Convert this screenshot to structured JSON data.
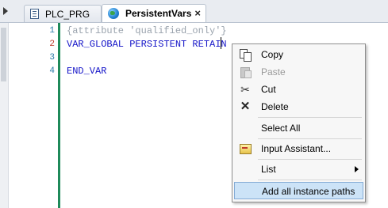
{
  "tabs": [
    {
      "label": "PLC_PRG",
      "icon": "program-icon",
      "active": false
    },
    {
      "label": "PersistentVars",
      "icon": "globe-icon",
      "active": true
    }
  ],
  "tab_close": "×",
  "editor": {
    "lines": [
      {
        "number": "1",
        "text": "{attribute 'qualified_only'}"
      },
      {
        "number": "2",
        "text": "VAR_GLOBAL PERSISTENT RETAIN"
      },
      {
        "number": "3",
        "text": ""
      },
      {
        "number": "4",
        "text": "END_VAR"
      }
    ]
  },
  "context_menu": {
    "items": [
      {
        "label": "Copy",
        "icon": "copy-icon",
        "enabled": true
      },
      {
        "label": "Paste",
        "icon": "paste-icon",
        "enabled": false
      },
      {
        "label": "Cut",
        "icon": "cut-icon",
        "enabled": true
      },
      {
        "label": "Delete",
        "icon": "delete-icon",
        "enabled": true
      },
      {
        "label": "Select All",
        "icon": "",
        "enabled": true
      },
      {
        "label": "Input Assistant...",
        "icon": "input-assistant-icon",
        "enabled": true
      },
      {
        "label": "List",
        "icon": "",
        "enabled": true,
        "submenu": true
      },
      {
        "label": "Add all instance paths",
        "icon": "",
        "enabled": true,
        "highlighted": true
      }
    ]
  },
  "colors": {
    "keyword": "#1414c8",
    "attribute": "#9aa3ad",
    "line_number": "#2b7aa8",
    "changed_line_number": "#c0392b",
    "gutter_bar": "#1f8a5a",
    "menu_highlight": "#cce3f7"
  }
}
